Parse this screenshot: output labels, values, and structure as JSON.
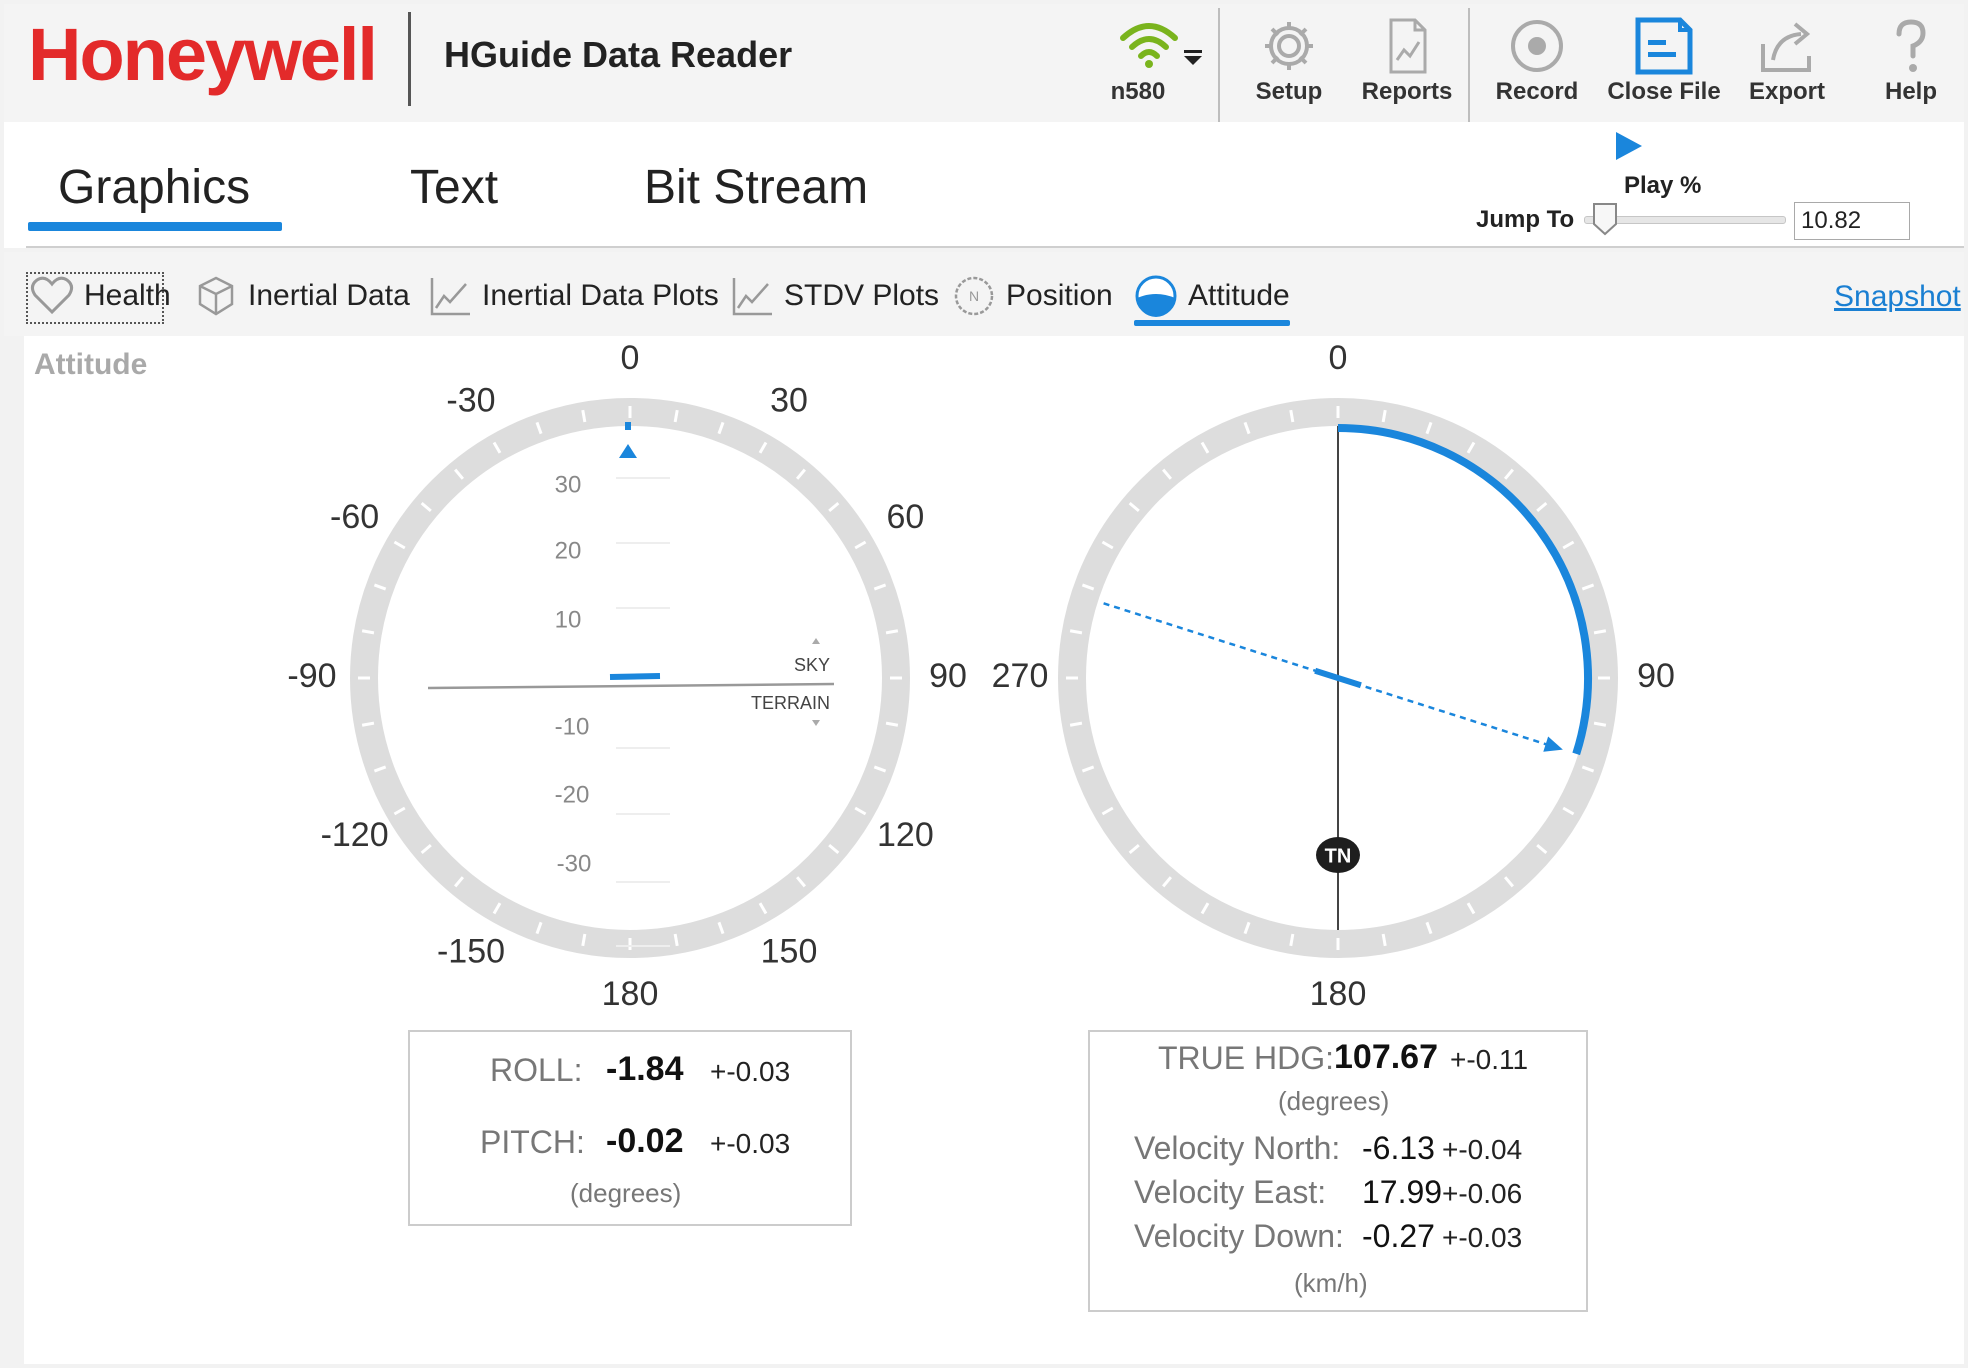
{
  "header": {
    "brand": "Honeywell",
    "app_title": "HGuide Data Reader",
    "device": {
      "name": "n580",
      "icon": "wifi-signal-icon"
    },
    "toolbar": [
      {
        "id": "setup",
        "label": "Setup",
        "icon": "gear-icon"
      },
      {
        "id": "reports",
        "label": "Reports",
        "icon": "report-icon"
      },
      {
        "id": "record",
        "label": "Record",
        "icon": "record-icon"
      },
      {
        "id": "close_file",
        "label": "Close File",
        "icon": "close-file-icon",
        "highlight": "#1a86dc"
      },
      {
        "id": "export",
        "label": "Export",
        "icon": "export-icon"
      },
      {
        "id": "help",
        "label": "Help",
        "icon": "help-icon"
      }
    ]
  },
  "tabs": {
    "items": [
      "Graphics",
      "Text",
      "Bit Stream"
    ],
    "active": "Graphics"
  },
  "playback": {
    "play_label": "Play %",
    "jump_label": "Jump To",
    "jump_value": "10.82",
    "slider_fraction": 0.1082
  },
  "subtabs": {
    "items": [
      {
        "label": "Health",
        "icon": "heart-icon"
      },
      {
        "label": "Inertial Data",
        "icon": "cube-icon"
      },
      {
        "label": "Inertial Data Plots",
        "icon": "line-chart-icon"
      },
      {
        "label": "STDV Plots",
        "icon": "line-chart-icon"
      },
      {
        "label": "Position",
        "icon": "compass-north-icon"
      },
      {
        "label": "Attitude",
        "icon": "attitude-icon"
      }
    ],
    "active": "Attitude",
    "snapshot": "Snapshot"
  },
  "attitude": {
    "section_title": "Attitude",
    "roll_dial": {
      "labels": [
        "0",
        "30",
        "60",
        "90",
        "120",
        "150",
        "180",
        "-150",
        "-120",
        "-90",
        "-60",
        "-30"
      ],
      "pitch_labels": [
        "30",
        "20",
        "10",
        "-10",
        "-20",
        "-30"
      ],
      "sky_label": "SKY",
      "terrain_label": "TERRAIN"
    },
    "heading_dial": {
      "labels": [
        "0",
        "90",
        "180",
        "270"
      ],
      "tn_label": "TN",
      "heading_deg": 107.67
    },
    "roll_panel": {
      "roll_key": "ROLL:",
      "roll_value": "-1.84",
      "roll_std": "+-0.03",
      "pitch_key": "PITCH:",
      "pitch_value": "-0.02",
      "pitch_std": "+-0.03",
      "unit": "(degrees)"
    },
    "heading_panel": {
      "hdg_key": "TRUE HDG:",
      "hdg_value": "107.67",
      "hdg_std": "+-0.11",
      "hdg_unit": "(degrees)",
      "vel_north_key": "Velocity North:",
      "vel_north_value": "-6.13",
      "vel_north_std": "+-0.04",
      "vel_east_key": "Velocity East:",
      "vel_east_value": "17.99",
      "vel_east_std": "+-0.06",
      "vel_down_key": "Velocity Down:",
      "vel_down_value": "-0.27",
      "vel_down_std": "+-0.03",
      "vel_unit": "(km/h)"
    }
  },
  "colors": {
    "brand_red": "#e32a2a",
    "accent_blue": "#1a86dc",
    "wifi_green": "#7ab41d",
    "dial_ring": "#dddddd"
  }
}
